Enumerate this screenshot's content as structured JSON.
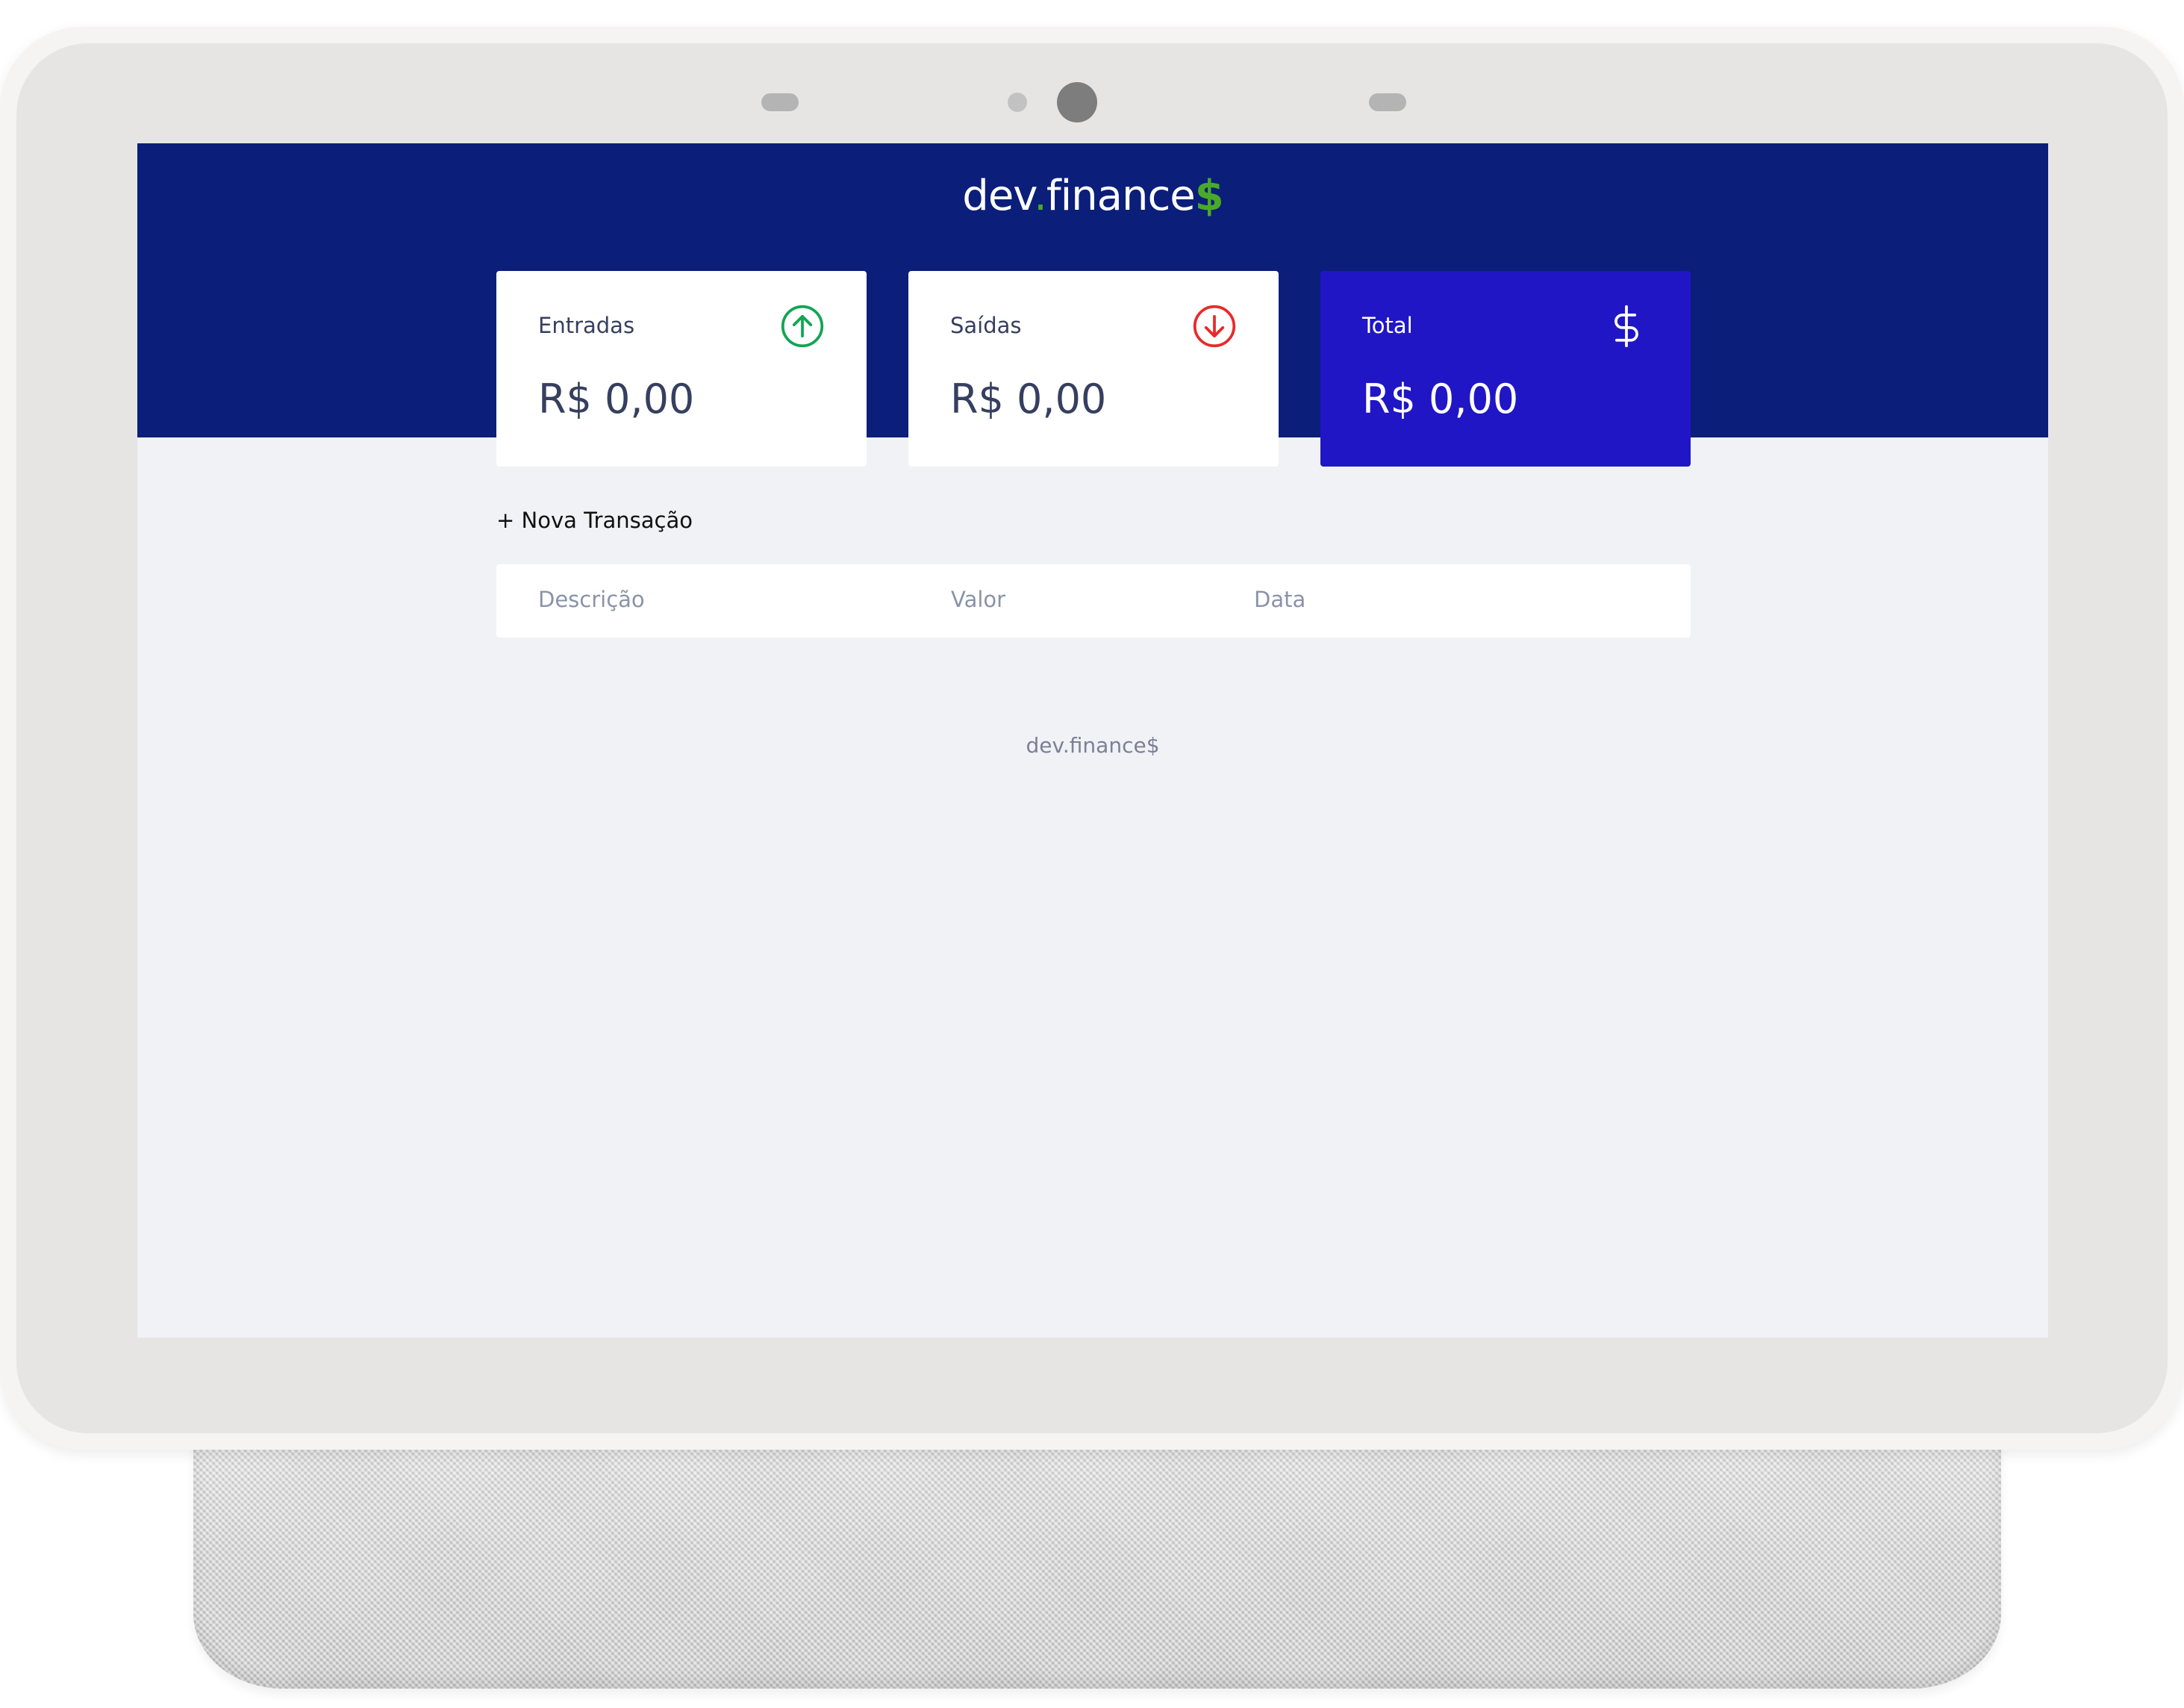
{
  "logo": {
    "part1": "dev",
    "dot": ".",
    "part2": "finance",
    "dollar": "$"
  },
  "cards": {
    "income": {
      "label": "Entradas",
      "value": "R$ 0,00",
      "icon": "arrow-up-circle-icon",
      "color": "#12a454"
    },
    "expense": {
      "label": "Saídas",
      "value": "R$ 0,00",
      "icon": "arrow-down-circle-icon",
      "color": "#e92929"
    },
    "total": {
      "label": "Total",
      "value": "R$ 0,00",
      "icon": "dollar-sign-icon",
      "color": "#ffffff"
    }
  },
  "new_transaction": {
    "label": "+ Nova Transação"
  },
  "table": {
    "headers": [
      "Descrição",
      "Valor",
      "Data"
    ]
  },
  "footer": {
    "text": "dev.finance$"
  },
  "colors": {
    "header_bg": "#0b1e7a",
    "screen_bg": "#f0f2f5",
    "total_card_bg": "#2016c6",
    "accent_green": "#49aa26"
  }
}
